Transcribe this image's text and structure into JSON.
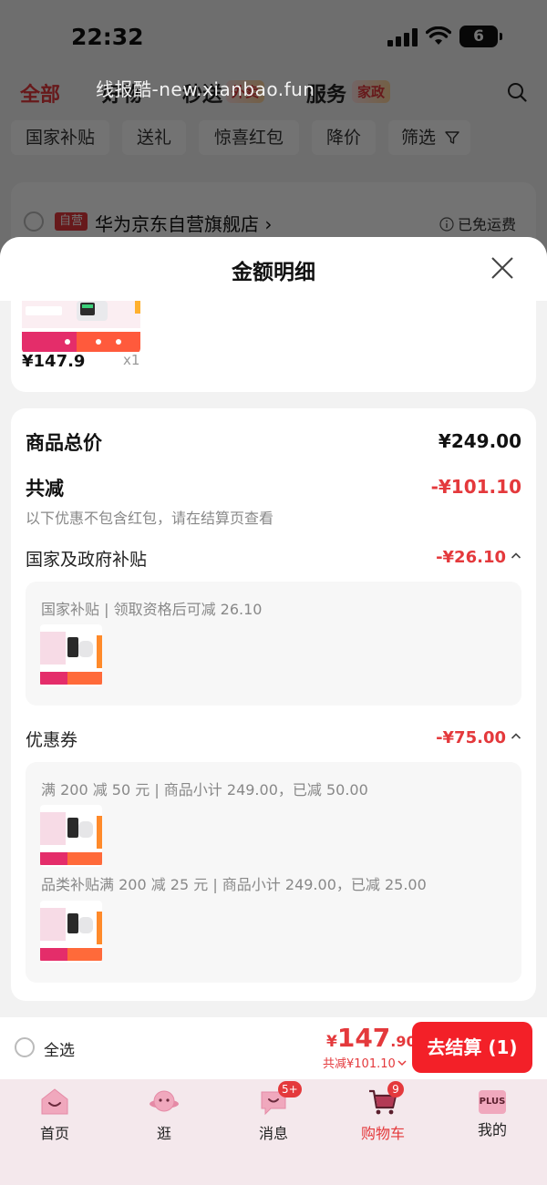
{
  "status_bar": {
    "time": "22:32",
    "battery": "6"
  },
  "top_tabs": [
    {
      "label": "全部"
    },
    {
      "label": "好物"
    },
    {
      "label": "秒送",
      "badge": "外卖"
    },
    {
      "label": "服务",
      "badge": "家政"
    }
  ],
  "watermark": "线报酷-new.xianbao.fun",
  "filters": [
    "国家补贴",
    "送礼",
    "惊喜红包",
    "降价",
    "筛选"
  ],
  "store": {
    "badge": "自营",
    "name": "华为京东自营旗舰店 ›",
    "shipping": "已免运费"
  },
  "sheet": {
    "title": "金额明细",
    "product": {
      "price": "¥147.9",
      "qty": "x1"
    },
    "total_label": "商品总价",
    "total_value": "¥249.00",
    "reduce_label": "共减",
    "reduce_value": "-¥101.10",
    "reduce_note": "以下优惠不包含红包，请在结算页查看",
    "subsidy": {
      "label": "国家及政府补贴",
      "value": "-¥26.10",
      "detail": "国家补贴 | 领取资格后可减 26.10"
    },
    "coupon": {
      "label": "优惠券",
      "value": "-¥75.00",
      "items": [
        "满 200 减 50 元 | 商品小计 249.00，已减 50.00",
        "品类补贴满 200 减 25 元 | 商品小计 249.00，已减 25.00"
      ]
    }
  },
  "checkout": {
    "select_all": "全选",
    "price_yen": "¥",
    "price_int": "147",
    "price_dec": ".90",
    "saved": "共减¥101.10",
    "button": "去结算 (1)"
  },
  "tabbar": [
    {
      "label": "首页"
    },
    {
      "label": "逛"
    },
    {
      "label": "消息",
      "badge": "5+"
    },
    {
      "label": "购物车",
      "badge": "9"
    },
    {
      "label": "我的",
      "icon_text": "PLUS"
    }
  ],
  "colors": {
    "accent": "#e4393c",
    "button": "#f32028",
    "tabbar_bg": "#f4e8ec"
  }
}
